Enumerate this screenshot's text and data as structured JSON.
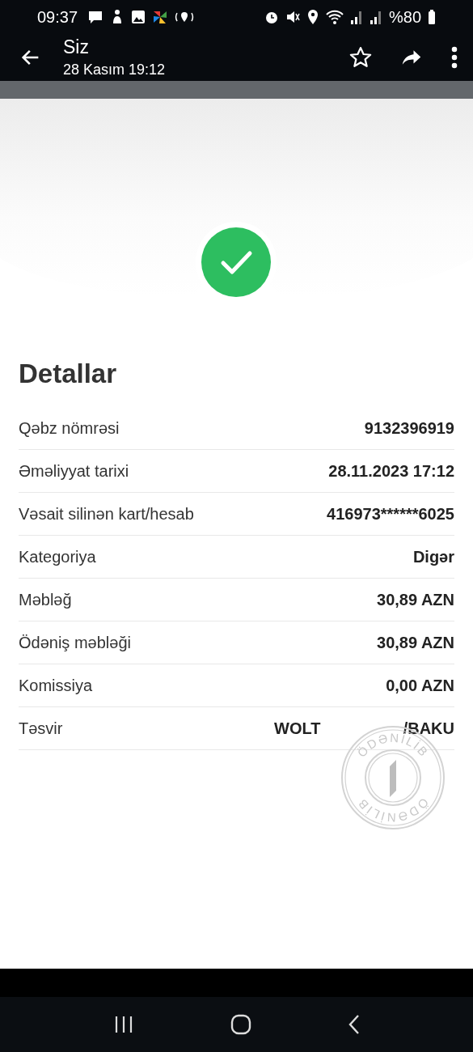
{
  "status_bar": {
    "time": "09:37",
    "battery": "%80"
  },
  "app_bar": {
    "title": "Siz",
    "subtitle": "28 Kasım 19:12"
  },
  "details": {
    "title": "Detallar",
    "rows": [
      {
        "label": "Qəbz nömrəsi",
        "values": [
          "9132396919"
        ]
      },
      {
        "label": "Əməliyyat tarixi",
        "values": [
          "28.11.2023 17:12"
        ]
      },
      {
        "label": "Vəsait silinən kart/hesab",
        "values": [
          "416973******6025"
        ]
      },
      {
        "label": "Kategoriya",
        "values": [
          "Digər"
        ]
      },
      {
        "label": "Məbləğ",
        "values": [
          "30,89 AZN"
        ]
      },
      {
        "label": "Ödəniş məbləği",
        "values": [
          "30,89 AZN"
        ]
      },
      {
        "label": "Komissiya",
        "values": [
          "0,00 AZN"
        ]
      },
      {
        "label": "Təsvir",
        "values": [
          "WOLT",
          "/BAKU"
        ]
      }
    ]
  },
  "stamp": {
    "top_text": "ÖDƏNİLİB",
    "bottom_text": "ÖDƏNİLİB"
  }
}
